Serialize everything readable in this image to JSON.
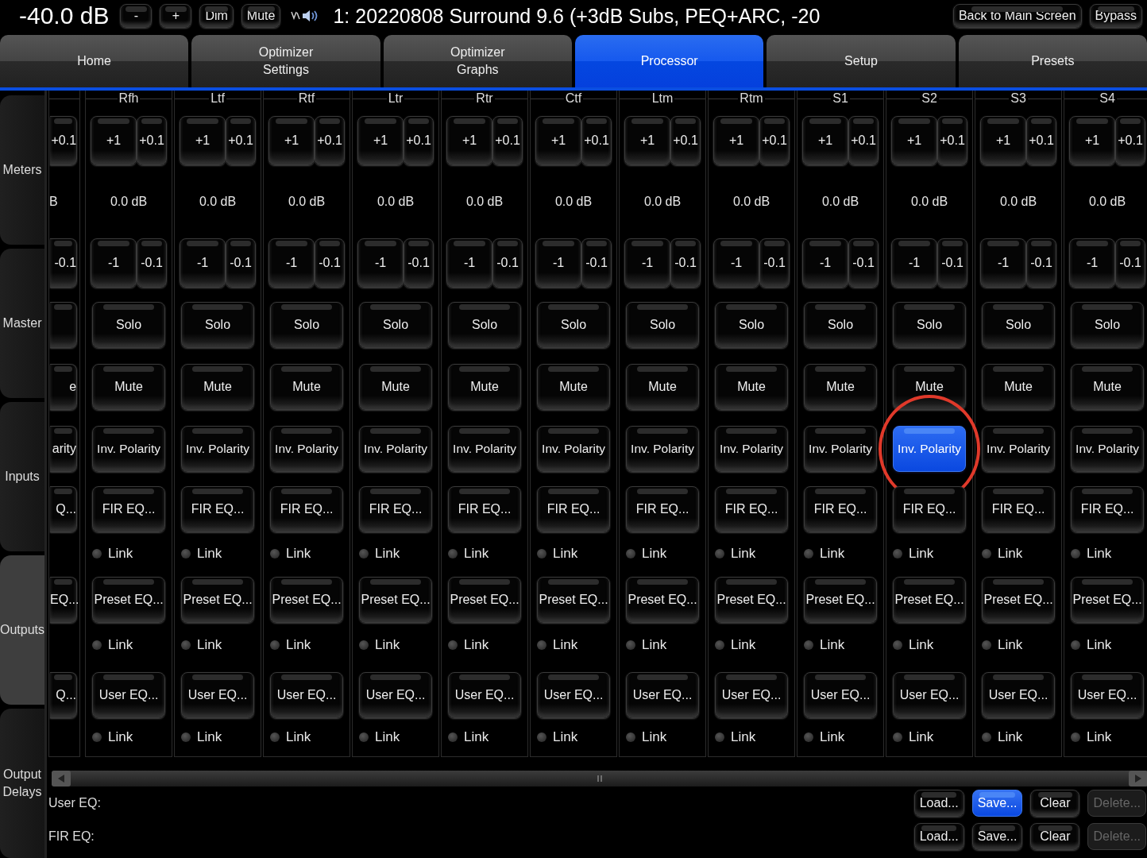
{
  "top_bar": {
    "volume": "-40.0 dB",
    "buttons": [
      "-",
      "+",
      "Dim",
      "Mute"
    ],
    "preset_title": "1: 20220808 Surround 9.6 (+3dB Subs, PEQ+ARC, -20",
    "right_buttons": [
      "Back to Main Screen",
      "Bypass"
    ]
  },
  "tabs": [
    {
      "label": "Home",
      "selected": false
    },
    {
      "label": "Optimizer\nSettings",
      "selected": false
    },
    {
      "label": "Optimizer\nGraphs",
      "selected": false
    },
    {
      "label": "Processor",
      "selected": true
    },
    {
      "label": "Setup",
      "selected": false
    },
    {
      "label": "Presets",
      "selected": false
    }
  ],
  "sidebar": {
    "items": [
      {
        "label": "Meters",
        "selected": false
      },
      {
        "label": "Master",
        "selected": false
      },
      {
        "label": "Inputs",
        "selected": false
      },
      {
        "label": "Outputs",
        "selected": true
      },
      {
        "label": "Output\nDelays",
        "selected": false
      }
    ]
  },
  "clipped_channel": {
    "plus_fine": "+0.1",
    "gain": "B",
    "minus_fine": "-0.1",
    "mute": "e",
    "polarity": "arity",
    "fir": "Q...",
    "preset": "EQ...",
    "user": "Q..."
  },
  "channels": [
    {
      "name": "Rfh",
      "plus_coarse": "+1",
      "plus_fine": "+0.1",
      "gain": "0.0 dB",
      "minus_coarse": "-1",
      "minus_fine": "-0.1",
      "solo": "Solo",
      "mute": "Mute",
      "polarity": {
        "label": "Inv. Polarity",
        "selected": false,
        "circled": false
      },
      "fir": "FIR EQ...",
      "fir_link": {
        "label": "Link",
        "on": false
      },
      "preset": "Preset EQ...",
      "preset_link": {
        "label": "Link",
        "on": false
      },
      "user": "User EQ...",
      "user_link": {
        "label": "Link",
        "on": false
      }
    },
    {
      "name": "Ltf",
      "plus_coarse": "+1",
      "plus_fine": "+0.1",
      "gain": "0.0 dB",
      "minus_coarse": "-1",
      "minus_fine": "-0.1",
      "solo": "Solo",
      "mute": "Mute",
      "polarity": {
        "label": "Inv. Polarity",
        "selected": false,
        "circled": false
      },
      "fir": "FIR EQ...",
      "fir_link": {
        "label": "Link",
        "on": false
      },
      "preset": "Preset EQ...",
      "preset_link": {
        "label": "Link",
        "on": false
      },
      "user": "User EQ...",
      "user_link": {
        "label": "Link",
        "on": false
      }
    },
    {
      "name": "Rtf",
      "plus_coarse": "+1",
      "plus_fine": "+0.1",
      "gain": "0.0 dB",
      "minus_coarse": "-1",
      "minus_fine": "-0.1",
      "solo": "Solo",
      "mute": "Mute",
      "polarity": {
        "label": "Inv. Polarity",
        "selected": false,
        "circled": false
      },
      "fir": "FIR EQ...",
      "fir_link": {
        "label": "Link",
        "on": false
      },
      "preset": "Preset EQ...",
      "preset_link": {
        "label": "Link",
        "on": false
      },
      "user": "User EQ...",
      "user_link": {
        "label": "Link",
        "on": false
      }
    },
    {
      "name": "Ltr",
      "plus_coarse": "+1",
      "plus_fine": "+0.1",
      "gain": "0.0 dB",
      "minus_coarse": "-1",
      "minus_fine": "-0.1",
      "solo": "Solo",
      "mute": "Mute",
      "polarity": {
        "label": "Inv. Polarity",
        "selected": false,
        "circled": false
      },
      "fir": "FIR EQ...",
      "fir_link": {
        "label": "Link",
        "on": false
      },
      "preset": "Preset EQ...",
      "preset_link": {
        "label": "Link",
        "on": false
      },
      "user": "User EQ...",
      "user_link": {
        "label": "Link",
        "on": false
      }
    },
    {
      "name": "Rtr",
      "plus_coarse": "+1",
      "plus_fine": "+0.1",
      "gain": "0.0 dB",
      "minus_coarse": "-1",
      "minus_fine": "-0.1",
      "solo": "Solo",
      "mute": "Mute",
      "polarity": {
        "label": "Inv. Polarity",
        "selected": false,
        "circled": false
      },
      "fir": "FIR EQ...",
      "fir_link": {
        "label": "Link",
        "on": false
      },
      "preset": "Preset EQ...",
      "preset_link": {
        "label": "Link",
        "on": false
      },
      "user": "User EQ...",
      "user_link": {
        "label": "Link",
        "on": false
      }
    },
    {
      "name": "Ctf",
      "plus_coarse": "+1",
      "plus_fine": "+0.1",
      "gain": "0.0 dB",
      "minus_coarse": "-1",
      "minus_fine": "-0.1",
      "solo": "Solo",
      "mute": "Mute",
      "polarity": {
        "label": "Inv. Polarity",
        "selected": false,
        "circled": false
      },
      "fir": "FIR EQ...",
      "fir_link": {
        "label": "Link",
        "on": false
      },
      "preset": "Preset EQ...",
      "preset_link": {
        "label": "Link",
        "on": false
      },
      "user": "User EQ...",
      "user_link": {
        "label": "Link",
        "on": false
      }
    },
    {
      "name": "Ltm",
      "plus_coarse": "+1",
      "plus_fine": "+0.1",
      "gain": "0.0 dB",
      "minus_coarse": "-1",
      "minus_fine": "-0.1",
      "solo": "Solo",
      "mute": "Mute",
      "polarity": {
        "label": "Inv. Polarity",
        "selected": false,
        "circled": false
      },
      "fir": "FIR EQ...",
      "fir_link": {
        "label": "Link",
        "on": false
      },
      "preset": "Preset EQ...",
      "preset_link": {
        "label": "Link",
        "on": false
      },
      "user": "User EQ...",
      "user_link": {
        "label": "Link",
        "on": false
      }
    },
    {
      "name": "Rtm",
      "plus_coarse": "+1",
      "plus_fine": "+0.1",
      "gain": "0.0 dB",
      "minus_coarse": "-1",
      "minus_fine": "-0.1",
      "solo": "Solo",
      "mute": "Mute",
      "polarity": {
        "label": "Inv. Polarity",
        "selected": false,
        "circled": false
      },
      "fir": "FIR EQ...",
      "fir_link": {
        "label": "Link",
        "on": false
      },
      "preset": "Preset EQ...",
      "preset_link": {
        "label": "Link",
        "on": false
      },
      "user": "User EQ...",
      "user_link": {
        "label": "Link",
        "on": false
      }
    },
    {
      "name": "S1",
      "plus_coarse": "+1",
      "plus_fine": "+0.1",
      "gain": "0.0 dB",
      "minus_coarse": "-1",
      "minus_fine": "-0.1",
      "solo": "Solo",
      "mute": "Mute",
      "polarity": {
        "label": "Inv. Polarity",
        "selected": false,
        "circled": false
      },
      "fir": "FIR EQ...",
      "fir_link": {
        "label": "Link",
        "on": false
      },
      "preset": "Preset EQ...",
      "preset_link": {
        "label": "Link",
        "on": false
      },
      "user": "User EQ...",
      "user_link": {
        "label": "Link",
        "on": false
      }
    },
    {
      "name": "S2",
      "plus_coarse": "+1",
      "plus_fine": "+0.1",
      "gain": "0.0 dB",
      "minus_coarse": "-1",
      "minus_fine": "-0.1",
      "solo": "Solo",
      "mute": "Mute",
      "polarity": {
        "label": "Inv. Polarity",
        "selected": true,
        "circled": true
      },
      "fir": "FIR EQ...",
      "fir_link": {
        "label": "Link",
        "on": false
      },
      "preset": "Preset EQ...",
      "preset_link": {
        "label": "Link",
        "on": false
      },
      "user": "User EQ...",
      "user_link": {
        "label": "Link",
        "on": false
      }
    },
    {
      "name": "S3",
      "plus_coarse": "+1",
      "plus_fine": "+0.1",
      "gain": "0.0 dB",
      "minus_coarse": "-1",
      "minus_fine": "-0.1",
      "solo": "Solo",
      "mute": "Mute",
      "polarity": {
        "label": "Inv. Polarity",
        "selected": false,
        "circled": false
      },
      "fir": "FIR EQ...",
      "fir_link": {
        "label": "Link",
        "on": false
      },
      "preset": "Preset EQ...",
      "preset_link": {
        "label": "Link",
        "on": false
      },
      "user": "User EQ...",
      "user_link": {
        "label": "Link",
        "on": false
      }
    },
    {
      "name": "S4",
      "plus_coarse": "+1",
      "plus_fine": "+0.1",
      "gain": "0.0 dB",
      "minus_coarse": "-1",
      "minus_fine": "-0.1",
      "solo": "Solo",
      "mute": "Mute",
      "polarity": {
        "label": "Inv. Polarity",
        "selected": false,
        "circled": false
      },
      "fir": "FIR EQ...",
      "fir_link": {
        "label": "Link",
        "on": false
      },
      "preset": "Preset EQ...",
      "preset_link": {
        "label": "Link",
        "on": false
      },
      "user": "User EQ...",
      "user_link": {
        "label": "Link",
        "on": false
      }
    }
  ],
  "eq_rows": [
    {
      "label": "User EQ:",
      "buttons": [
        {
          "label": "Load...",
          "selected": false,
          "disabled": false
        },
        {
          "label": "Save...",
          "selected": true,
          "disabled": false
        },
        {
          "label": "Clear",
          "selected": false,
          "disabled": false
        },
        {
          "label": "Delete...",
          "selected": false,
          "disabled": true
        }
      ]
    },
    {
      "label": "FIR EQ:",
      "buttons": [
        {
          "label": "Load...",
          "selected": false,
          "disabled": false
        },
        {
          "label": "Save...",
          "selected": false,
          "disabled": false
        },
        {
          "label": "Clear",
          "selected": false,
          "disabled": false
        },
        {
          "label": "Delete...",
          "selected": false,
          "disabled": true
        }
      ]
    }
  ]
}
